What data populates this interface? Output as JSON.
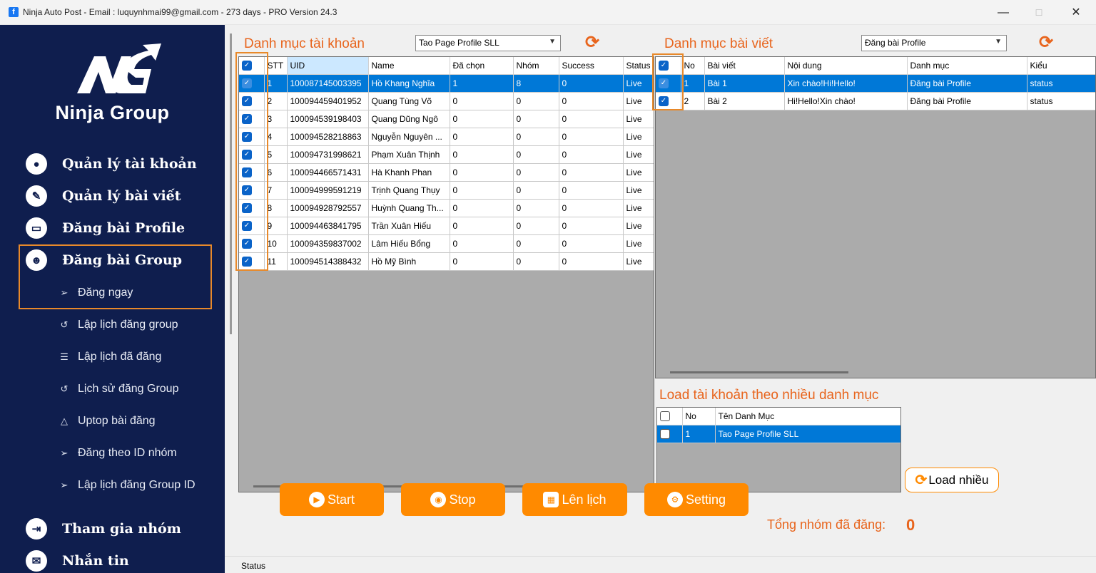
{
  "window": {
    "title": "Ninja Auto Post - Email : luquynhmai99@gmail.com - 273 days -  PRO Version 24.3",
    "minimize": "—",
    "maximize": "☐",
    "close": "✕"
  },
  "sidebar": {
    "brand": "Ninja Group",
    "main_items": [
      {
        "label": "Quản lý tài khoản",
        "icon": "user-icon"
      },
      {
        "label": "Quản lý bài viết",
        "icon": "pencil-icon"
      },
      {
        "label": "Đăng bài Profile",
        "icon": "monitor-icon"
      },
      {
        "label": "Đăng bài Group",
        "icon": "group-icon"
      },
      {
        "label": "Tham gia nhóm",
        "icon": "join-icon"
      },
      {
        "label": "Nhắn tin",
        "icon": "message-icon"
      }
    ],
    "sub_items": [
      {
        "label": "Đăng ngay",
        "icon": "send-icon"
      },
      {
        "label": "Lập lịch đăng group",
        "icon": "history-icon"
      },
      {
        "label": "Lập lịch đã đăng",
        "icon": "list-icon"
      },
      {
        "label": "Lịch sử đăng Group",
        "icon": "history-icon"
      },
      {
        "label": "Uptop bài đăng",
        "icon": "triangle-up-icon"
      },
      {
        "label": "Đăng theo ID nhóm",
        "icon": "send-icon"
      },
      {
        "label": "Lập lịch đăng Group ID",
        "icon": "send-icon"
      }
    ]
  },
  "accounts": {
    "title": "Danh mục tài khoản",
    "combo_value": "Tao Page Profile SLL",
    "columns": [
      "STT",
      "UID",
      "Name",
      "Đã chọn",
      "Nhóm",
      "Success",
      "Status"
    ],
    "rows": [
      {
        "stt": "1",
        "uid": "100087145003395",
        "name": "Hồ Khang Nghĩa",
        "chosen": "1",
        "groups": "8",
        "success": "0",
        "status": "Live"
      },
      {
        "stt": "2",
        "uid": "100094459401952",
        "name": "Quang Tùng Võ",
        "chosen": "0",
        "groups": "0",
        "success": "0",
        "status": "Live"
      },
      {
        "stt": "3",
        "uid": "100094539198403",
        "name": "Quang Dũng Ngô",
        "chosen": "0",
        "groups": "0",
        "success": "0",
        "status": "Live"
      },
      {
        "stt": "4",
        "uid": "100094528218863",
        "name": "Nguyễn Nguyên ...",
        "chosen": "0",
        "groups": "0",
        "success": "0",
        "status": "Live"
      },
      {
        "stt": "5",
        "uid": "100094731998621",
        "name": "Phạm Xuân Thịnh",
        "chosen": "0",
        "groups": "0",
        "success": "0",
        "status": "Live"
      },
      {
        "stt": "6",
        "uid": "100094466571431",
        "name": "Hà Khanh Phan",
        "chosen": "0",
        "groups": "0",
        "success": "0",
        "status": "Live"
      },
      {
        "stt": "7",
        "uid": "100094999591219",
        "name": "Trịnh Quang Thụy",
        "chosen": "0",
        "groups": "0",
        "success": "0",
        "status": "Live"
      },
      {
        "stt": "8",
        "uid": "100094928792557",
        "name": "Huỳnh Quang Th...",
        "chosen": "0",
        "groups": "0",
        "success": "0",
        "status": "Live"
      },
      {
        "stt": "9",
        "uid": "100094463841795",
        "name": "Trần Xuân Hiếu",
        "chosen": "0",
        "groups": "0",
        "success": "0",
        "status": "Live"
      },
      {
        "stt": "10",
        "uid": "100094359837002",
        "name": "Lâm Hiếu Bổng",
        "chosen": "0",
        "groups": "0",
        "success": "0",
        "status": "Live"
      },
      {
        "stt": "11",
        "uid": "100094514388432",
        "name": "Hồ Mỹ Bình",
        "chosen": "0",
        "groups": "0",
        "success": "0",
        "status": "Live"
      }
    ]
  },
  "posts": {
    "title": "Danh mục bài viết",
    "combo_value": "Đăng bài Profile",
    "columns": [
      "No",
      "Bài viết",
      "Nội dung",
      "Danh mục",
      "Kiểu"
    ],
    "rows": [
      {
        "no": "1",
        "post": "Bài 1",
        "content": "Xin chào!Hi!Hello!",
        "category": "Đăng bài Profile",
        "type": "status"
      },
      {
        "no": "2",
        "post": "Bài 2",
        "content": "Hi!Hello!Xin chào!",
        "category": "Đăng bài Profile",
        "type": "status"
      }
    ]
  },
  "load_multi": {
    "title": "Load tài khoản theo nhiều danh mục",
    "columns": [
      "No",
      "Tên Danh Mục"
    ],
    "rows": [
      {
        "no": "1",
        "name": "Tao Page Profile SLL"
      }
    ],
    "button": "Load nhiều"
  },
  "actions": {
    "start": "Start",
    "stop": "Stop",
    "schedule": "Lên lịch",
    "setting": "Setting",
    "total_label": "Tổng nhóm đã đăng:",
    "total_value": "0"
  },
  "statusbar": {
    "text": "Status"
  },
  "colors": {
    "accent": "#ff8a00",
    "title_orange": "#e8641c",
    "sidebar_bg": "#0f1e4e",
    "selection": "#0078d7"
  }
}
